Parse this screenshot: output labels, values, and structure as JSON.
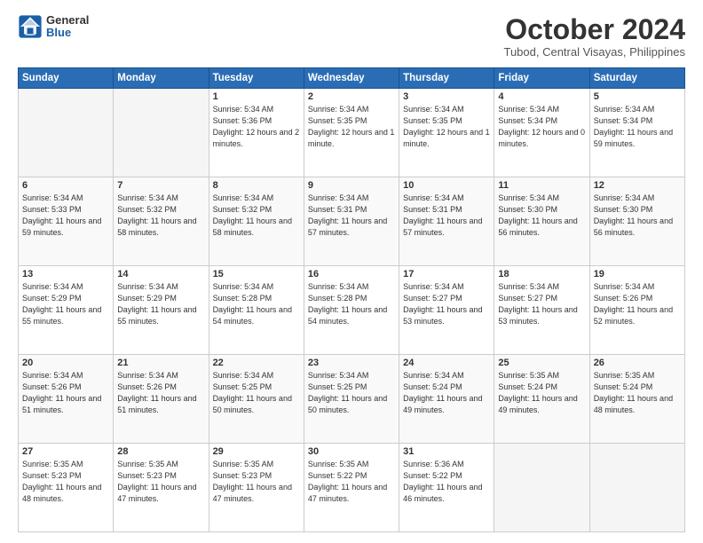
{
  "header": {
    "logo": {
      "general": "General",
      "blue": "Blue"
    },
    "title": "October 2024",
    "location": "Tubod, Central Visayas, Philippines"
  },
  "days_of_week": [
    "Sunday",
    "Monday",
    "Tuesday",
    "Wednesday",
    "Thursday",
    "Friday",
    "Saturday"
  ],
  "weeks": [
    [
      {
        "day": "",
        "empty": true
      },
      {
        "day": "",
        "empty": true
      },
      {
        "day": "1",
        "sunrise": "5:34 AM",
        "sunset": "5:36 PM",
        "daylight": "12 hours and 2 minutes."
      },
      {
        "day": "2",
        "sunrise": "5:34 AM",
        "sunset": "5:35 PM",
        "daylight": "12 hours and 1 minute."
      },
      {
        "day": "3",
        "sunrise": "5:34 AM",
        "sunset": "5:35 PM",
        "daylight": "12 hours and 1 minute."
      },
      {
        "day": "4",
        "sunrise": "5:34 AM",
        "sunset": "5:34 PM",
        "daylight": "12 hours and 0 minutes."
      },
      {
        "day": "5",
        "sunrise": "5:34 AM",
        "sunset": "5:34 PM",
        "daylight": "11 hours and 59 minutes."
      }
    ],
    [
      {
        "day": "6",
        "sunrise": "5:34 AM",
        "sunset": "5:33 PM",
        "daylight": "11 hours and 59 minutes."
      },
      {
        "day": "7",
        "sunrise": "5:34 AM",
        "sunset": "5:32 PM",
        "daylight": "11 hours and 58 minutes."
      },
      {
        "day": "8",
        "sunrise": "5:34 AM",
        "sunset": "5:32 PM",
        "daylight": "11 hours and 58 minutes."
      },
      {
        "day": "9",
        "sunrise": "5:34 AM",
        "sunset": "5:31 PM",
        "daylight": "11 hours and 57 minutes."
      },
      {
        "day": "10",
        "sunrise": "5:34 AM",
        "sunset": "5:31 PM",
        "daylight": "11 hours and 57 minutes."
      },
      {
        "day": "11",
        "sunrise": "5:34 AM",
        "sunset": "5:30 PM",
        "daylight": "11 hours and 56 minutes."
      },
      {
        "day": "12",
        "sunrise": "5:34 AM",
        "sunset": "5:30 PM",
        "daylight": "11 hours and 56 minutes."
      }
    ],
    [
      {
        "day": "13",
        "sunrise": "5:34 AM",
        "sunset": "5:29 PM",
        "daylight": "11 hours and 55 minutes."
      },
      {
        "day": "14",
        "sunrise": "5:34 AM",
        "sunset": "5:29 PM",
        "daylight": "11 hours and 55 minutes."
      },
      {
        "day": "15",
        "sunrise": "5:34 AM",
        "sunset": "5:28 PM",
        "daylight": "11 hours and 54 minutes."
      },
      {
        "day": "16",
        "sunrise": "5:34 AM",
        "sunset": "5:28 PM",
        "daylight": "11 hours and 54 minutes."
      },
      {
        "day": "17",
        "sunrise": "5:34 AM",
        "sunset": "5:27 PM",
        "daylight": "11 hours and 53 minutes."
      },
      {
        "day": "18",
        "sunrise": "5:34 AM",
        "sunset": "5:27 PM",
        "daylight": "11 hours and 53 minutes."
      },
      {
        "day": "19",
        "sunrise": "5:34 AM",
        "sunset": "5:26 PM",
        "daylight": "11 hours and 52 minutes."
      }
    ],
    [
      {
        "day": "20",
        "sunrise": "5:34 AM",
        "sunset": "5:26 PM",
        "daylight": "11 hours and 51 minutes."
      },
      {
        "day": "21",
        "sunrise": "5:34 AM",
        "sunset": "5:26 PM",
        "daylight": "11 hours and 51 minutes."
      },
      {
        "day": "22",
        "sunrise": "5:34 AM",
        "sunset": "5:25 PM",
        "daylight": "11 hours and 50 minutes."
      },
      {
        "day": "23",
        "sunrise": "5:34 AM",
        "sunset": "5:25 PM",
        "daylight": "11 hours and 50 minutes."
      },
      {
        "day": "24",
        "sunrise": "5:34 AM",
        "sunset": "5:24 PM",
        "daylight": "11 hours and 49 minutes."
      },
      {
        "day": "25",
        "sunrise": "5:35 AM",
        "sunset": "5:24 PM",
        "daylight": "11 hours and 49 minutes."
      },
      {
        "day": "26",
        "sunrise": "5:35 AM",
        "sunset": "5:24 PM",
        "daylight": "11 hours and 48 minutes."
      }
    ],
    [
      {
        "day": "27",
        "sunrise": "5:35 AM",
        "sunset": "5:23 PM",
        "daylight": "11 hours and 48 minutes."
      },
      {
        "day": "28",
        "sunrise": "5:35 AM",
        "sunset": "5:23 PM",
        "daylight": "11 hours and 47 minutes."
      },
      {
        "day": "29",
        "sunrise": "5:35 AM",
        "sunset": "5:23 PM",
        "daylight": "11 hours and 47 minutes."
      },
      {
        "day": "30",
        "sunrise": "5:35 AM",
        "sunset": "5:22 PM",
        "daylight": "11 hours and 47 minutes."
      },
      {
        "day": "31",
        "sunrise": "5:36 AM",
        "sunset": "5:22 PM",
        "daylight": "11 hours and 46 minutes."
      },
      {
        "day": "",
        "empty": true
      },
      {
        "day": "",
        "empty": true
      }
    ]
  ],
  "labels": {
    "sunrise": "Sunrise:",
    "sunset": "Sunset:",
    "daylight": "Daylight:"
  }
}
